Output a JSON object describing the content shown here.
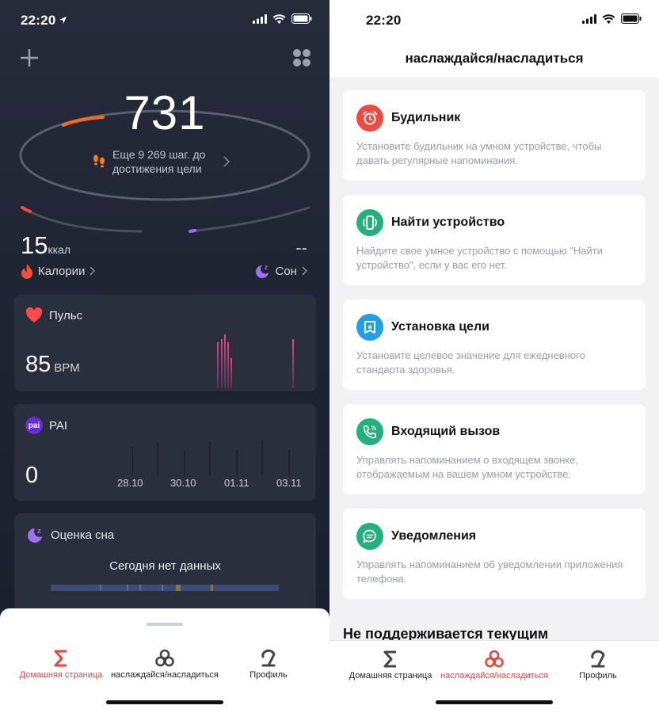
{
  "left": {
    "status": {
      "time": "22:20"
    },
    "steps": {
      "value": "731",
      "goal_text": "Еще 9 269 шаг. до достижения цели"
    },
    "calories": {
      "value": "15",
      "unit": "ккал",
      "label": "Калории"
    },
    "sleep_stat": {
      "value": "--",
      "label": "Сон"
    },
    "pulse": {
      "title": "Пульс",
      "value": "85",
      "unit": "BPM"
    },
    "pai": {
      "title": "PAI",
      "badge": "pai",
      "value": "0",
      "dates": [
        "28.10",
        "30.10",
        "01.11",
        "03.11"
      ]
    },
    "sleep_card": {
      "title": "Оценка сна",
      "message": "Сегодня нет данных"
    },
    "tabs": [
      {
        "label": "Домашняя страница",
        "icon": "sigma-icon",
        "active": true
      },
      {
        "label": "наслаждайся/насладиться",
        "icon": "enjoy-icon",
        "active": false
      },
      {
        "label": "Профиль",
        "icon": "profile-icon",
        "active": false
      }
    ]
  },
  "right": {
    "status": {
      "time": "22:20"
    },
    "title": "наслаждайся/насладиться",
    "cards": [
      {
        "title": "Будильник",
        "desc": "Установите будильник на умном устройстве, чтобы давать регулярные напоминания.",
        "icon": "alarm-clock-icon",
        "color": "#ef4a3f"
      },
      {
        "title": "Найти устройство",
        "desc": "Найдите свое умное устройство с помощью \"Найти устройство\", если у вас его нет.",
        "icon": "find-device-icon",
        "color": "#22b07d"
      },
      {
        "title": "Установка цели",
        "desc": "Установите целевое значение для ежедневного стандарта здоровья.",
        "icon": "goal-icon",
        "color": "#1ea1e6"
      },
      {
        "title": "Входящий вызов",
        "desc": "Управлять напоминанием о входящем звонке, отображаемым на вашем умном устройстве.",
        "icon": "incoming-call-icon",
        "color": "#22b07d"
      },
      {
        "title": "Уведомления",
        "desc": "Управлять напоминанием об уведомлении приложения телефона.",
        "icon": "notification-icon",
        "color": "#22b07d"
      }
    ],
    "section_title": "Не поддерживается текущим",
    "tabs": [
      {
        "label": "Домашняя страница",
        "icon": "sigma-icon",
        "active": false
      },
      {
        "label": "наслаждайся/насладиться",
        "icon": "enjoy-icon",
        "active": true
      },
      {
        "label": "Профиль",
        "icon": "profile-icon",
        "active": false
      }
    ]
  },
  "colors": {
    "accent": "#e8453c",
    "pulse": "#e8408c",
    "pai": "#6a2bd9",
    "sleep": "#9b6cf0"
  }
}
